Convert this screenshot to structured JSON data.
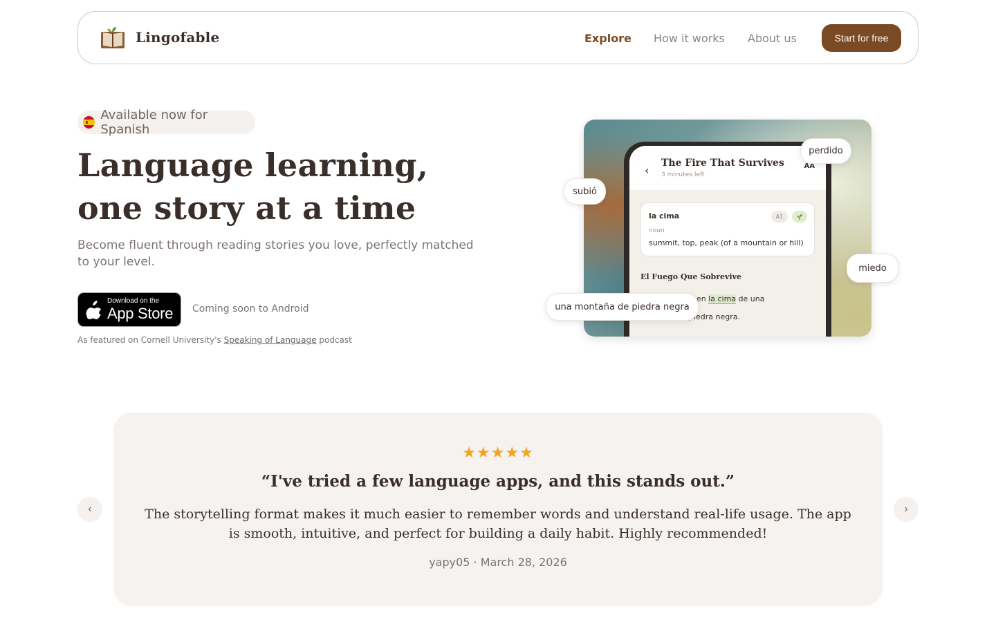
{
  "nav": {
    "brand": "Lingofable",
    "links": [
      "Explore",
      "How it works",
      "About us"
    ],
    "cta": "Start for free"
  },
  "hero": {
    "badge": "Available now for Spanish",
    "headline_line1": "Language learning,",
    "headline_line2": "one story at a time",
    "subhead": "Become fluent through reading stories you love, perfectly matched to your level.",
    "appstore_small": "Download on the",
    "appstore_big": "App Store",
    "android": "Coming soon to Android",
    "featured_prefix": "As featured on Cornell University's ",
    "featured_link": "Speaking of Language",
    "featured_suffix": " podcast"
  },
  "phone": {
    "story_title": "The Fire That Survives",
    "story_meta": "3 minutes left",
    "text_size_label": "AA",
    "word": "la cima",
    "level": "A1",
    "part_of_speech": "noun",
    "definition": "summit, top, peak (of a mountain or hill)",
    "chapter_title": "El Fuego Que Sobrevive",
    "line1_before": "Se quedó solo en ",
    "line1_highlight": "la cima",
    "line1_after": " de una",
    "line2": "montaña de piedra negra."
  },
  "bubbles": {
    "b1": "perdido",
    "b2": "subió",
    "b3": "miedo",
    "b4": "una montaña de piedra negra"
  },
  "testimonial": {
    "stars": "★★★★★",
    "rating": 5,
    "title": "“I've tried a few language apps, and this stands out.”",
    "body": "The storytelling format makes it much easier to remember words and understand real-life usage. The app is smooth, intuitive, and perfect for building a daily habit. Highly recommended!",
    "author": "yapy05 · March 28, 2026",
    "prev": "‹",
    "next": "›"
  },
  "colors": {
    "brand_brown": "#7a4a24",
    "text_dark": "#3a2e2a",
    "star": "#f0a51c",
    "card_bg": "#f5f2ef"
  }
}
